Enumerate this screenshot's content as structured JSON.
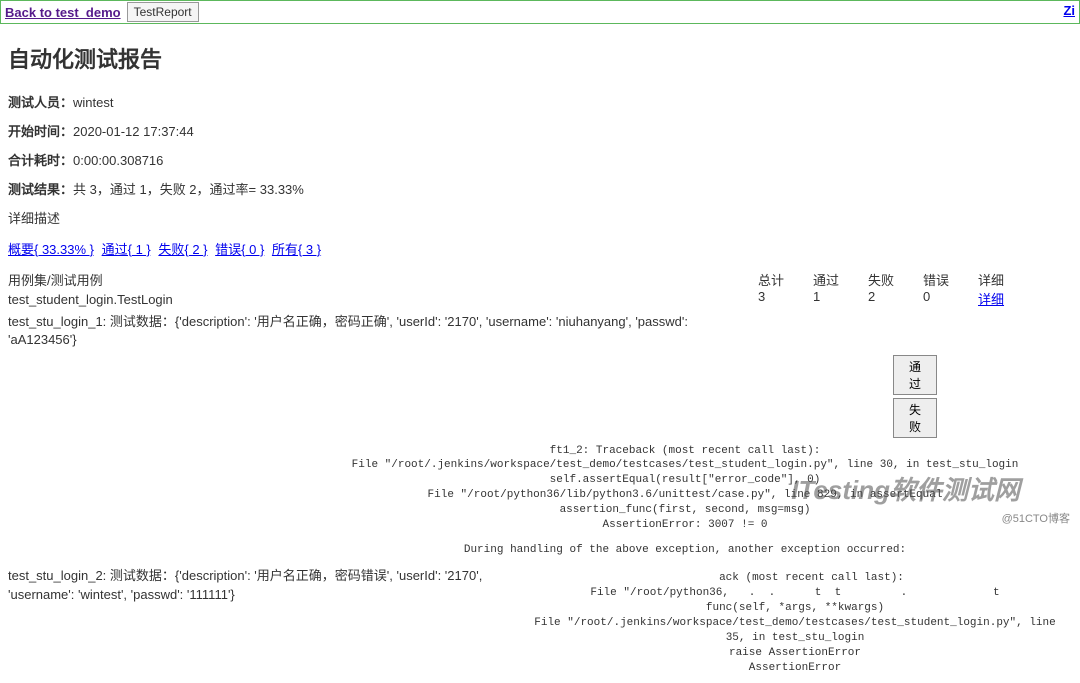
{
  "topbar": {
    "back": "Back to test_demo",
    "tab": "TestReport",
    "right": "Zi"
  },
  "title": "自动化测试报告",
  "meta": {
    "tester_label": "测试人员：",
    "tester_value": "wintest",
    "start_label": "开始时间：",
    "start_value": "2020-01-12 17:37:44",
    "duration_label": "合计耗时：",
    "duration_value": "0:00:00.308716",
    "result_label": "测试结果：",
    "result_value": "共 3，通过 1，失败 2，通过率= 33.33%",
    "detail_desc": "详细描述"
  },
  "filters": {
    "summary": "概要{ 33.33% }",
    "pass": "通过{ 1 }",
    "fail": "失败{ 2 }",
    "error": "错误{ 0 }",
    "all": "所有{ 3 }"
  },
  "table": {
    "h_case": "用例集/测试用例",
    "h_total": "总计",
    "h_pass": "通过",
    "h_fail": "失败",
    "h_error": "错误",
    "h_detail": "详细",
    "suite": "test_student_login.TestLogin",
    "total": "3",
    "pass": "1",
    "fail": "2",
    "error": "0",
    "detail_link": "详细"
  },
  "case1": "test_stu_login_1: 测试数据：{'description': '用户名正确，密码正确', 'userId': '2170', 'username': 'niuhanyang', 'passwd': 'aA123456'}",
  "btn": {
    "pass": "通过",
    "fail": "失败"
  },
  "traceback1": "ft1_2: Traceback (most recent call last):\nFile \"/root/.jenkins/workspace/test_demo/testcases/test_student_login.py\", line 30, in test_stu_login\nself.assertEqual(result[\"error_code\"], 0)\nFile \"/root/python36/lib/python3.6/unittest/case.py\", line 829, in assertEqual\nassertion_func(first, second, msg=msg)\nAssertionError: 3007 != 0",
  "between": "During handling of the above exception, another exception occurred:",
  "case2": "test_stu_login_2: 测试数据：{'description': '用户名正确，密码错误', 'userId': '2170', 'username': 'wintest', 'passwd': '111111'}",
  "traceback2": "     ack (most recent call last):\nFile \"/root/python36,   .  .      t  t         .             t\nfunc(self, *args, **kwargs)\nFile \"/root/.jenkins/workspace/test_demo/testcases/test_student_login.py\", line 35, in test_stu_login\nraise AssertionError\nAssertionError",
  "watermark": "ITesting软件测试网",
  "footnote": "@51CTO博客"
}
